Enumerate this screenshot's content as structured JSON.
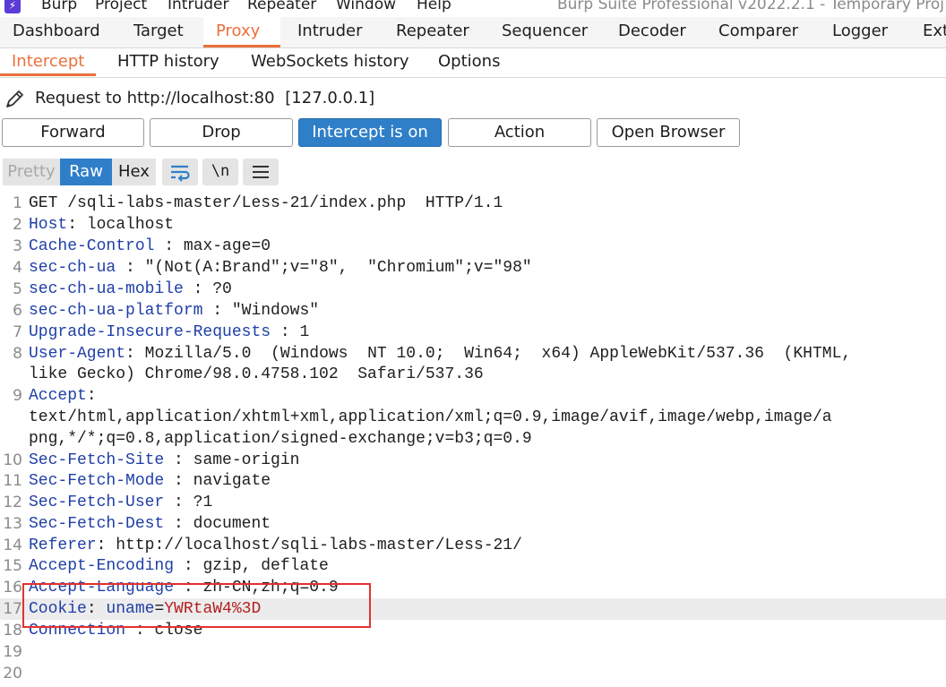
{
  "menubar": {
    "items": [
      "Burp",
      "Project",
      "Intruder",
      "Repeater",
      "Window",
      "Help"
    ],
    "window_title": "Burp Suite Professional v2022.2.1 - Temporary Proj"
  },
  "main_tabs": [
    "Dashboard",
    "Target",
    "Proxy",
    "Intruder",
    "Repeater",
    "Sequencer",
    "Decoder",
    "Comparer",
    "Logger",
    "Ext"
  ],
  "active_main_tab": "Proxy",
  "sub_tabs": [
    "Intercept",
    "HTTP history",
    "WebSockets history",
    "Options"
  ],
  "active_sub_tab": "Intercept",
  "request_info": {
    "label": "Request to http://localhost:80",
    "ip": "[127.0.0.1]"
  },
  "buttons": {
    "forward": "Forward",
    "drop": "Drop",
    "intercept": "Intercept is on",
    "action": "Action",
    "open_browser": "Open Browser"
  },
  "editor_toolbar": {
    "pretty": "Pretty",
    "raw": "Raw",
    "hex": "Hex",
    "newline": "\\n",
    "active_view": "Raw"
  },
  "request_lines": [
    {
      "num": "1",
      "name": "",
      "sep": "",
      "value": "GET /sqli-labs-master/Less-21/index.php  HTTP/1.1"
    },
    {
      "num": "2",
      "name": "Host",
      "sep": ": ",
      "value": "localhost"
    },
    {
      "num": "3",
      "name": "Cache-Control",
      "sep": " : ",
      "value": "max-age=0"
    },
    {
      "num": "4",
      "name": "sec-ch-ua",
      "sep": " : ",
      "value": "\"(Not(A:Brand\";v=\"8\",  \"Chromium\";v=\"98\""
    },
    {
      "num": "5",
      "name": "sec-ch-ua-mobile",
      "sep": " : ",
      "value": "?0"
    },
    {
      "num": "6",
      "name": "sec-ch-ua-platform",
      "sep": " : ",
      "value": "\"Windows\""
    },
    {
      "num": "7",
      "name": "Upgrade-Insecure-Requests",
      "sep": " : ",
      "value": "1"
    },
    {
      "num": "8",
      "name": "User-Agent",
      "sep": ": ",
      "value": "Mozilla/5.0  (Windows  NT 10.0;  Win64;  x64) AppleWebKit/537.36  (KHTML,"
    },
    {
      "num": "",
      "name": "",
      "sep": "",
      "value": "like Gecko) Chrome/98.0.4758.102  Safari/537.36"
    },
    {
      "num": "9",
      "name": "Accept",
      "sep": ":",
      "value": ""
    },
    {
      "num": "",
      "name": "",
      "sep": "",
      "value": "text/html,application/xhtml+xml,application/xml;q=0.9,image/avif,image/webp,image/a"
    },
    {
      "num": "",
      "name": "",
      "sep": "",
      "value": "png,*/*;q=0.8,application/signed-exchange;v=b3;q=0.9"
    },
    {
      "num": "10",
      "name": "Sec-Fetch-Site",
      "sep": " : ",
      "value": "same-origin"
    },
    {
      "num": "11",
      "name": "Sec-Fetch-Mode",
      "sep": " : ",
      "value": "navigate"
    },
    {
      "num": "12",
      "name": "Sec-Fetch-User",
      "sep": " : ",
      "value": "?1"
    },
    {
      "num": "13",
      "name": "Sec-Fetch-Dest",
      "sep": " : ",
      "value": "document"
    },
    {
      "num": "14",
      "name": "Referer",
      "sep": ": ",
      "value": "http://localhost/sqli-labs-master/Less-21/"
    },
    {
      "num": "15",
      "name": "Accept-Encoding",
      "sep": " : ",
      "value": "gzip, deflate"
    },
    {
      "num": "16",
      "name": "Accept-Language",
      "sep": " : ",
      "value": "zh-CN,zh;q=0.9"
    },
    {
      "num": "17",
      "name": "Cookie",
      "sep": ": ",
      "cookie_name": "uname",
      "cookie_eq": "=",
      "value": "YWRtaW4%3D"
    },
    {
      "num": "18",
      "name": "Connection",
      "sep": " : ",
      "value": "close"
    },
    {
      "num": "19",
      "name": "",
      "sep": "",
      "value": ""
    },
    {
      "num": "20",
      "name": "",
      "sep": "",
      "value": ""
    }
  ],
  "colors": {
    "accent": "#ec6f3b",
    "intercept_on": "#2f7fc8",
    "header_name": "#1f3fa8",
    "cookie_value": "#b32020",
    "highlight_box": "#e53030"
  }
}
